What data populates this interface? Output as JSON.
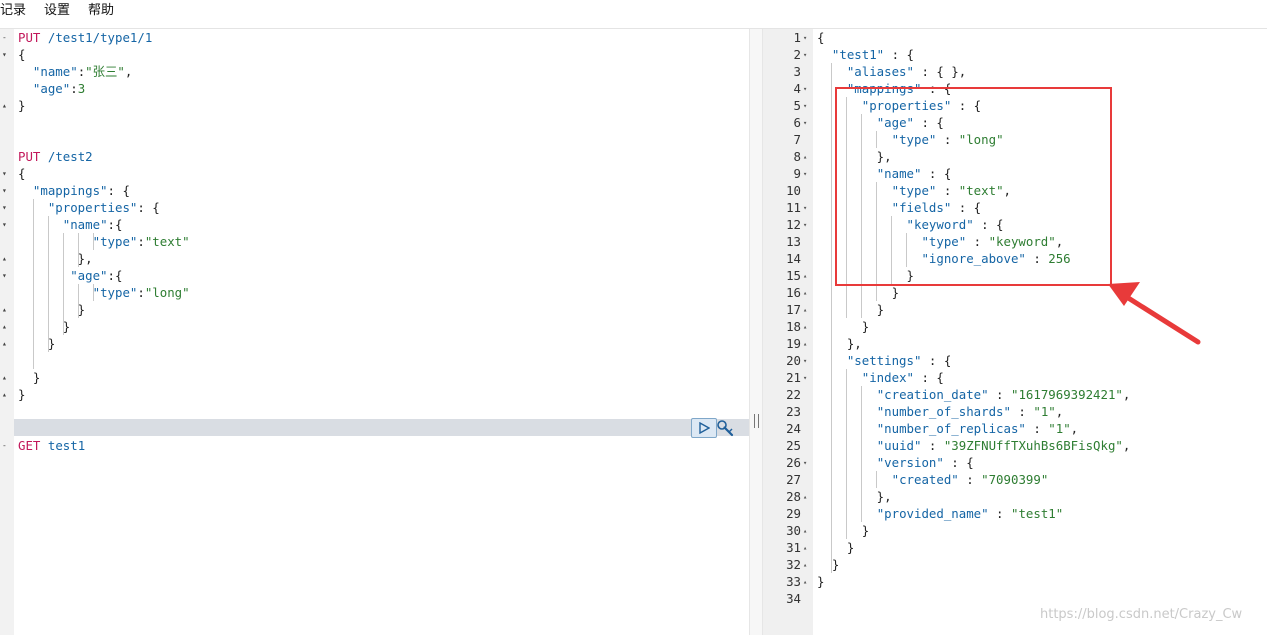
{
  "menu": {
    "items": [
      "记录",
      "设置",
      "帮助"
    ]
  },
  "left_editor": {
    "lines": [
      [
        {
          "c": "method",
          "t": "PUT"
        },
        {
          "c": "punc",
          "t": " "
        },
        {
          "c": "url",
          "t": "/test1/type1/1"
        }
      ],
      [
        {
          "c": "punc",
          "t": "{"
        }
      ],
      [
        {
          "c": "punc",
          "t": "  "
        },
        {
          "c": "key",
          "t": "\"name\""
        },
        {
          "c": "punc",
          "t": ":"
        },
        {
          "c": "str",
          "t": "\"张三\""
        },
        {
          "c": "punc",
          "t": ","
        }
      ],
      [
        {
          "c": "punc",
          "t": "  "
        },
        {
          "c": "key",
          "t": "\"age\""
        },
        {
          "c": "punc",
          "t": ":"
        },
        {
          "c": "num",
          "t": "3"
        }
      ],
      [
        {
          "c": "punc",
          "t": "}"
        }
      ],
      [],
      [],
      [
        {
          "c": "method",
          "t": "PUT"
        },
        {
          "c": "punc",
          "t": " "
        },
        {
          "c": "url",
          "t": "/test2"
        }
      ],
      [
        {
          "c": "punc",
          "t": "{"
        }
      ],
      [
        {
          "c": "punc",
          "t": "  "
        },
        {
          "c": "key",
          "t": "\"mappings\""
        },
        {
          "c": "punc",
          "t": ": {"
        }
      ],
      [
        {
          "c": "punc",
          "t": "    "
        },
        {
          "c": "key",
          "t": "\"properties\""
        },
        {
          "c": "punc",
          "t": ": {"
        }
      ],
      [
        {
          "c": "punc",
          "t": "      "
        },
        {
          "c": "key",
          "t": "\"name\""
        },
        {
          "c": "punc",
          "t": ":{"
        }
      ],
      [
        {
          "c": "punc",
          "t": "          "
        },
        {
          "c": "key",
          "t": "\"type\""
        },
        {
          "c": "punc",
          "t": ":"
        },
        {
          "c": "str",
          "t": "\"text\""
        }
      ],
      [
        {
          "c": "punc",
          "t": "        },"
        }
      ],
      [
        {
          "c": "punc",
          "t": "       "
        },
        {
          "c": "key",
          "t": "\"age\""
        },
        {
          "c": "punc",
          "t": ":{"
        }
      ],
      [
        {
          "c": "punc",
          "t": "          "
        },
        {
          "c": "key",
          "t": "\"type\""
        },
        {
          "c": "punc",
          "t": ":"
        },
        {
          "c": "str",
          "t": "\"long\""
        }
      ],
      [
        {
          "c": "punc",
          "t": "        }"
        }
      ],
      [
        {
          "c": "punc",
          "t": "      }"
        }
      ],
      [
        {
          "c": "punc",
          "t": "    }"
        }
      ],
      [],
      [
        {
          "c": "punc",
          "t": "  }"
        }
      ],
      [
        {
          "c": "punc",
          "t": "}"
        }
      ],
      [],
      [],
      [
        {
          "c": "method",
          "t": "GET"
        },
        {
          "c": "punc",
          "t": " "
        },
        {
          "c": "url",
          "t": "test1"
        }
      ]
    ],
    "fold_markers": [
      "-",
      "▾",
      "",
      "",
      "▴",
      "",
      "",
      "",
      "▾",
      "▾",
      "▾",
      "▾",
      "",
      "▴",
      "▾",
      "",
      "▴",
      "▴",
      "▴",
      "",
      "▴",
      "▴",
      "",
      "",
      "-"
    ]
  },
  "right_editor": {
    "lines": [
      [
        {
          "c": "punc",
          "t": "{"
        }
      ],
      [
        {
          "c": "punc",
          "t": "  "
        },
        {
          "c": "key",
          "t": "\"test1\""
        },
        {
          "c": "punc",
          "t": " : {"
        }
      ],
      [
        {
          "c": "punc",
          "t": "    "
        },
        {
          "c": "key",
          "t": "\"aliases\""
        },
        {
          "c": "punc",
          "t": " : { },"
        }
      ],
      [
        {
          "c": "punc",
          "t": "    "
        },
        {
          "c": "key",
          "t": "\"mappings\""
        },
        {
          "c": "punc",
          "t": " : {"
        }
      ],
      [
        {
          "c": "punc",
          "t": "      "
        },
        {
          "c": "key",
          "t": "\"properties\""
        },
        {
          "c": "punc",
          "t": " : {"
        }
      ],
      [
        {
          "c": "punc",
          "t": "        "
        },
        {
          "c": "key",
          "t": "\"age\""
        },
        {
          "c": "punc",
          "t": " : {"
        }
      ],
      [
        {
          "c": "punc",
          "t": "          "
        },
        {
          "c": "key",
          "t": "\"type\""
        },
        {
          "c": "punc",
          "t": " : "
        },
        {
          "c": "str",
          "t": "\"long\""
        }
      ],
      [
        {
          "c": "punc",
          "t": "        },"
        }
      ],
      [
        {
          "c": "punc",
          "t": "        "
        },
        {
          "c": "key",
          "t": "\"name\""
        },
        {
          "c": "punc",
          "t": " : {"
        }
      ],
      [
        {
          "c": "punc",
          "t": "          "
        },
        {
          "c": "key",
          "t": "\"type\""
        },
        {
          "c": "punc",
          "t": " : "
        },
        {
          "c": "str",
          "t": "\"text\""
        },
        {
          "c": "punc",
          "t": ","
        }
      ],
      [
        {
          "c": "punc",
          "t": "          "
        },
        {
          "c": "key",
          "t": "\"fields\""
        },
        {
          "c": "punc",
          "t": " : {"
        }
      ],
      [
        {
          "c": "punc",
          "t": "            "
        },
        {
          "c": "key",
          "t": "\"keyword\""
        },
        {
          "c": "punc",
          "t": " : {"
        }
      ],
      [
        {
          "c": "punc",
          "t": "              "
        },
        {
          "c": "key",
          "t": "\"type\""
        },
        {
          "c": "punc",
          "t": " : "
        },
        {
          "c": "str",
          "t": "\"keyword\""
        },
        {
          "c": "punc",
          "t": ","
        }
      ],
      [
        {
          "c": "punc",
          "t": "              "
        },
        {
          "c": "key",
          "t": "\"ignore_above\""
        },
        {
          "c": "punc",
          "t": " : "
        },
        {
          "c": "num",
          "t": "256"
        }
      ],
      [
        {
          "c": "punc",
          "t": "            }"
        }
      ],
      [
        {
          "c": "punc",
          "t": "          }"
        }
      ],
      [
        {
          "c": "punc",
          "t": "        }"
        }
      ],
      [
        {
          "c": "punc",
          "t": "      }"
        }
      ],
      [
        {
          "c": "punc",
          "t": "    },"
        }
      ],
      [
        {
          "c": "punc",
          "t": "    "
        },
        {
          "c": "key",
          "t": "\"settings\""
        },
        {
          "c": "punc",
          "t": " : {"
        }
      ],
      [
        {
          "c": "punc",
          "t": "      "
        },
        {
          "c": "key",
          "t": "\"index\""
        },
        {
          "c": "punc",
          "t": " : {"
        }
      ],
      [
        {
          "c": "punc",
          "t": "        "
        },
        {
          "c": "key",
          "t": "\"creation_date\""
        },
        {
          "c": "punc",
          "t": " : "
        },
        {
          "c": "str",
          "t": "\"1617969392421\""
        },
        {
          "c": "punc",
          "t": ","
        }
      ],
      [
        {
          "c": "punc",
          "t": "        "
        },
        {
          "c": "key",
          "t": "\"number_of_shards\""
        },
        {
          "c": "punc",
          "t": " : "
        },
        {
          "c": "str",
          "t": "\"1\""
        },
        {
          "c": "punc",
          "t": ","
        }
      ],
      [
        {
          "c": "punc",
          "t": "        "
        },
        {
          "c": "key",
          "t": "\"number_of_replicas\""
        },
        {
          "c": "punc",
          "t": " : "
        },
        {
          "c": "str",
          "t": "\"1\""
        },
        {
          "c": "punc",
          "t": ","
        }
      ],
      [
        {
          "c": "punc",
          "t": "        "
        },
        {
          "c": "key",
          "t": "\"uuid\""
        },
        {
          "c": "punc",
          "t": " : "
        },
        {
          "c": "str",
          "t": "\"39ZFNUffTXuhBs6BFisQkg\""
        },
        {
          "c": "punc",
          "t": ","
        }
      ],
      [
        {
          "c": "punc",
          "t": "        "
        },
        {
          "c": "key",
          "t": "\"version\""
        },
        {
          "c": "punc",
          "t": " : {"
        }
      ],
      [
        {
          "c": "punc",
          "t": "          "
        },
        {
          "c": "key",
          "t": "\"created\""
        },
        {
          "c": "punc",
          "t": " : "
        },
        {
          "c": "str",
          "t": "\"7090399\""
        }
      ],
      [
        {
          "c": "punc",
          "t": "        },"
        }
      ],
      [
        {
          "c": "punc",
          "t": "        "
        },
        {
          "c": "key",
          "t": "\"provided_name\""
        },
        {
          "c": "punc",
          "t": " : "
        },
        {
          "c": "str",
          "t": "\"test1\""
        }
      ],
      [
        {
          "c": "punc",
          "t": "      }"
        }
      ],
      [
        {
          "c": "punc",
          "t": "    }"
        }
      ],
      [
        {
          "c": "punc",
          "t": "  }"
        }
      ],
      [
        {
          "c": "punc",
          "t": "}"
        }
      ],
      []
    ],
    "line_numbers": [
      "1",
      "2",
      "3",
      "4",
      "5",
      "6",
      "7",
      "8",
      "9",
      "10",
      "11",
      "12",
      "13",
      "14",
      "15",
      "16",
      "17",
      "18",
      "19",
      "20",
      "21",
      "22",
      "23",
      "24",
      "25",
      "26",
      "27",
      "28",
      "29",
      "30",
      "31",
      "32",
      "33",
      "34"
    ],
    "fold_markers": [
      "▾",
      "▾",
      "",
      "▾",
      "▾",
      "▾",
      "",
      "▴",
      "▾",
      "",
      "▾",
      "▾",
      "",
      "",
      "▴",
      "▴",
      "▴",
      "▴",
      "▴",
      "▾",
      "▾",
      "",
      "",
      "",
      "",
      "▾",
      "",
      "▴",
      "",
      "▴",
      "▴",
      "▴",
      "▴",
      ""
    ]
  },
  "icons": {
    "run": "play-icon",
    "settings": "wrench-icon"
  },
  "colors": {
    "highlight_box": "#e83a3a",
    "arrow": "#e83a3a",
    "method": "#c2185b",
    "key": "#1565a5",
    "string": "#2e7d32"
  },
  "watermark": "https://blog.csdn.net/Crazy_Cw"
}
